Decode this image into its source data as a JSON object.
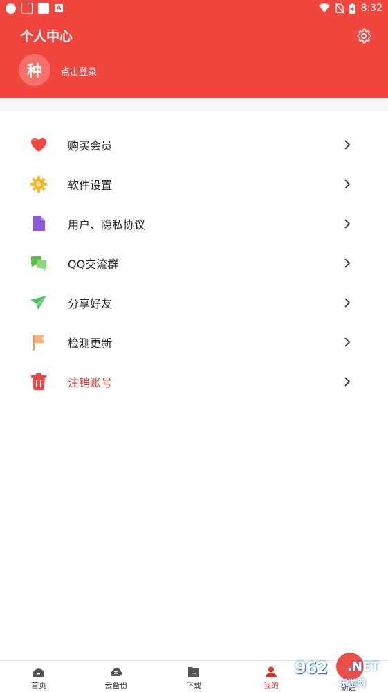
{
  "status_bar": {
    "time": "8:32",
    "left_icons": [
      "circle-app-icon",
      "news-app-icon",
      "square-app-icon",
      "a-app-icon"
    ],
    "right_icons": [
      "wifi-icon",
      "no-sim-icon",
      "battery-charging-icon"
    ]
  },
  "header": {
    "title": "个人中心",
    "avatar_char": "种",
    "login_text": "点击登录",
    "bg_color": "#f2453d"
  },
  "menu": {
    "items": [
      {
        "label": "购买会员",
        "icon": "heart-icon"
      },
      {
        "label": "软件设置",
        "icon": "gear-sun-icon"
      },
      {
        "label": "用户、隐私协议",
        "icon": "document-icon"
      },
      {
        "label": "QQ交流群",
        "icon": "chat-icon"
      },
      {
        "label": "分享好友",
        "icon": "paper-plane-icon"
      },
      {
        "label": "检测更新",
        "icon": "flag-icon"
      },
      {
        "label": "注销账号",
        "icon": "trash-icon",
        "color": "#e0322b"
      }
    ]
  },
  "bottom_nav": {
    "items": [
      {
        "label": "首页",
        "icon": "home-icon"
      },
      {
        "label": "云备份",
        "icon": "cloud-icon"
      },
      {
        "label": "下载",
        "icon": "folder-icon"
      },
      {
        "label": "我的",
        "icon": "user-icon",
        "active": true
      },
      {
        "label": "新建",
        "icon": "add-icon"
      }
    ],
    "active_color": "#e0322b"
  },
  "watermark": {
    "brand": "962",
    "suffix": ".NET",
    "sub": "乐游网"
  }
}
